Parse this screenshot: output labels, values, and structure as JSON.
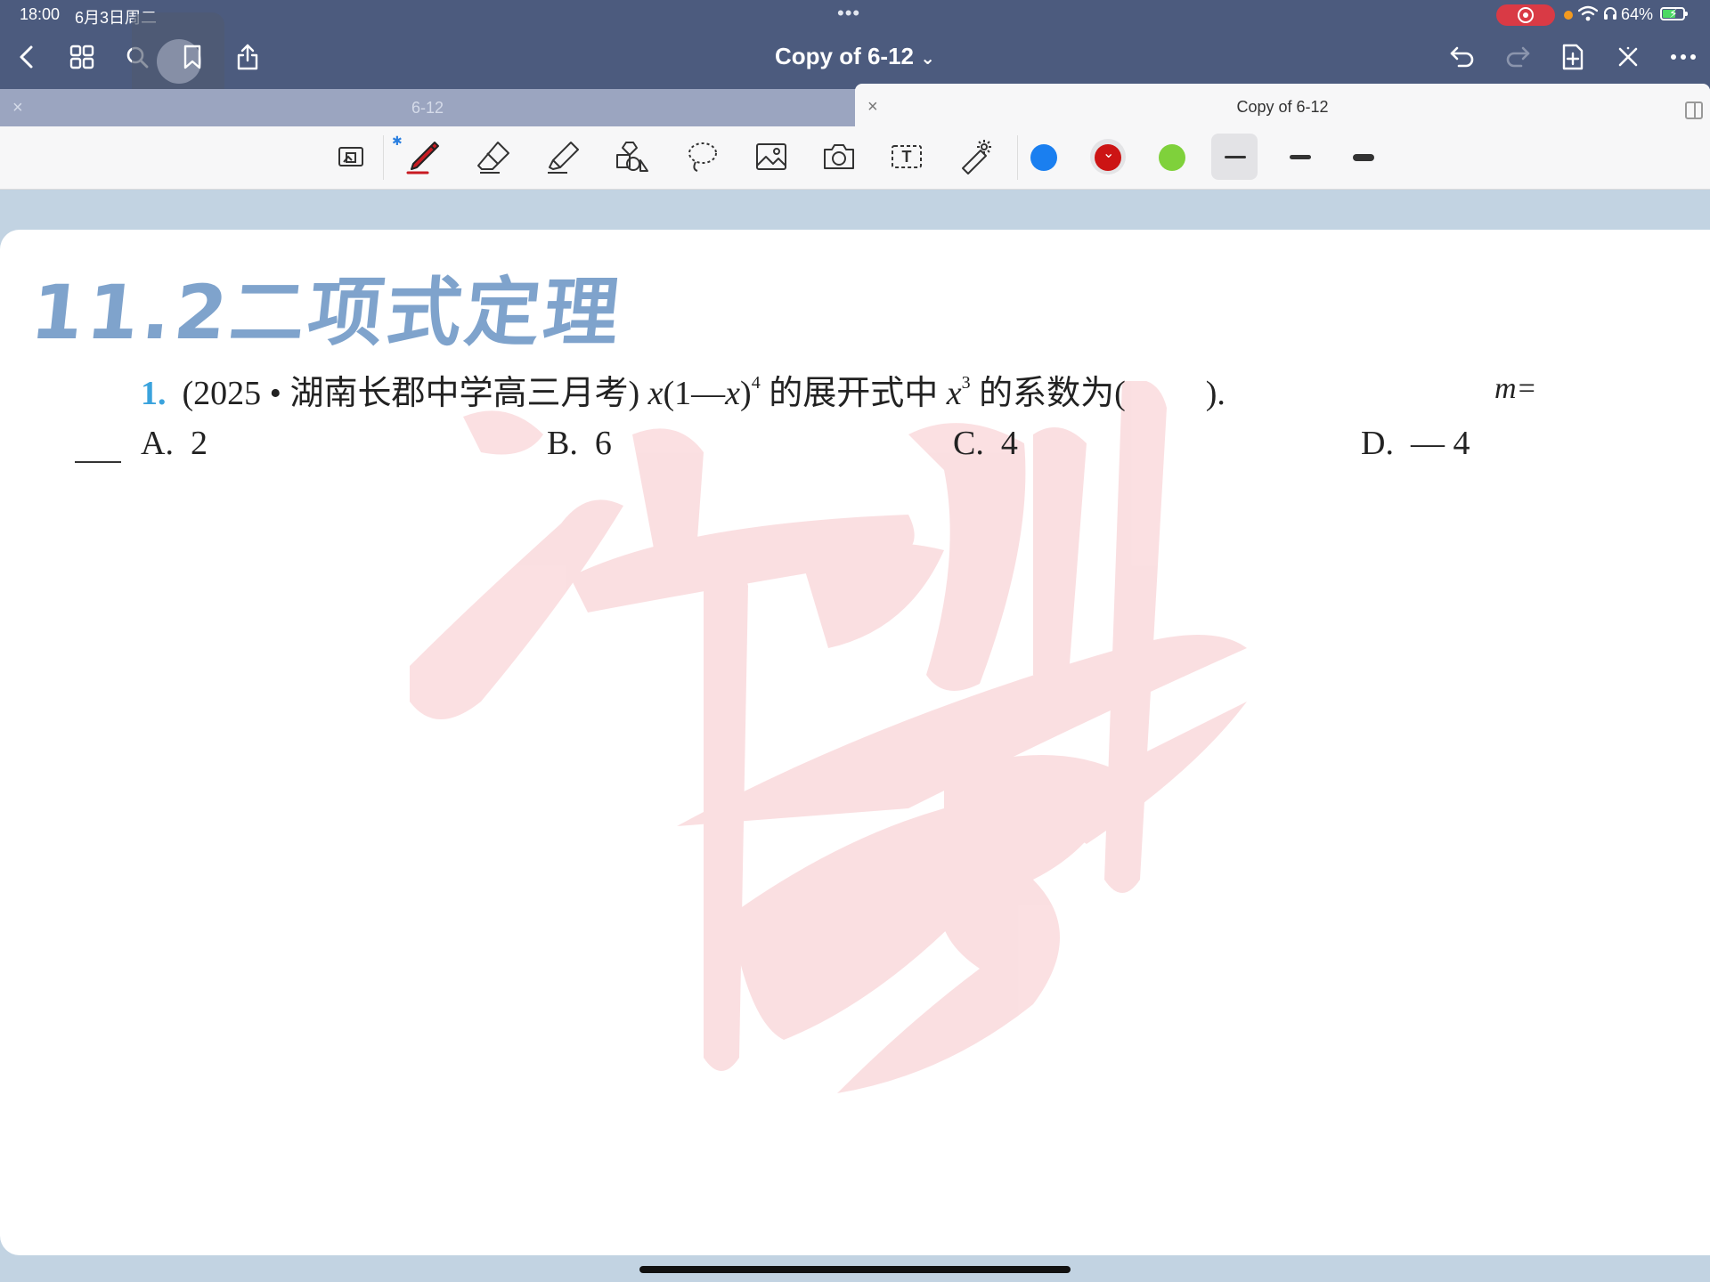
{
  "status_bar": {
    "time": "18:00",
    "date": "6月3日周二",
    "dots": "•••",
    "battery_percent": "64%",
    "battery_level": 0.64,
    "recording_color": "#d93a45"
  },
  "toolbar": {
    "title": "Copy of 6-12",
    "title_chevron": "⌄",
    "left_icons": [
      "back-icon",
      "grid-icon",
      "search-icon",
      "bookmark-icon",
      "share-icon"
    ],
    "right_icons": [
      "undo-icon",
      "redo-icon",
      "add-page-icon",
      "close-icon",
      "more-icon"
    ]
  },
  "tabs": [
    {
      "label": "6-12",
      "active": false,
      "close": "×"
    },
    {
      "label": "Copy of 6-12",
      "active": true,
      "close": "×"
    }
  ],
  "tools": {
    "items": [
      "read-mode-icon",
      "pen-icon",
      "eraser-icon",
      "highlighter-icon",
      "shapes-icon",
      "lasso-icon",
      "image-icon",
      "camera-icon",
      "text-icon",
      "laser-pointer-icon"
    ],
    "bluetooth_mark": "✱",
    "text_tool_glyph": "T",
    "colors": [
      "#1a7ff0",
      "#cc1414",
      "#7fd13b"
    ],
    "selected_color_mark": "⌄"
  },
  "document": {
    "heading": "11.2二项式定理",
    "question": {
      "number": "1.",
      "source": "(2025 • 湖南长郡中学高三月考)",
      "var_x": "x",
      "paren_open": "(1",
      "minus": "—",
      "var_x2": "x",
      "paren_close": ")",
      "exp1": "4",
      "mid": "的展开式中",
      "var_x3": "x",
      "exp2": "3",
      "tail": "的系数为(",
      "tail_end": ").",
      "m_label": "m="
    },
    "options": [
      {
        "letter": "A.",
        "value": "2"
      },
      {
        "letter": "B.",
        "value": "6"
      },
      {
        "letter": "C.",
        "value": "4"
      },
      {
        "letter": "D.",
        "value": "— 4"
      }
    ],
    "watermark_text": "冲刺985"
  }
}
